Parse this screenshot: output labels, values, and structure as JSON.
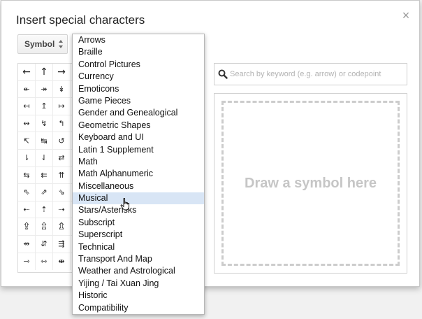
{
  "dialog": {
    "title": "Insert special characters",
    "close_glyph": "×"
  },
  "category_select": {
    "value": "Symbol"
  },
  "symbol_grid": {
    "rows": [
      [
        "←",
        "↑",
        "→"
      ],
      [
        "↞",
        "↠",
        "↡"
      ],
      [
        "↤",
        "↥",
        "↦"
      ],
      [
        "↭",
        "↯",
        "↰"
      ],
      [
        "↸",
        "↹",
        "↺"
      ],
      [
        "⇂",
        "⇃",
        "⇄"
      ],
      [
        "⇆",
        "⇇",
        "⇈"
      ],
      [
        "⇖",
        "⇗",
        "⇘"
      ],
      [
        "⇠",
        "⇡",
        "⇢"
      ],
      [
        "⇪",
        "⇫",
        "⇬"
      ],
      [
        "⇴",
        "⇵",
        "⇶"
      ],
      [
        "⇾",
        "⇿",
        "⇼"
      ]
    ]
  },
  "search": {
    "value": "",
    "placeholder": "Search by keyword (e.g. arrow) or codepoint",
    "icon": "search-icon"
  },
  "draw_area": {
    "label": "Draw a symbol here"
  },
  "dropdown": {
    "selected_index": 13,
    "options": [
      "Arrows",
      "Braille",
      "Control Pictures",
      "Currency",
      "Emoticons",
      "Game Pieces",
      "Gender and Genealogical",
      "Geometric Shapes",
      "Keyboard and UI",
      "Latin 1 Supplement",
      "Math",
      "Math Alphanumeric",
      "Miscellaneous",
      "Musical",
      "Stars/Asterisks",
      "Subscript",
      "Superscript",
      "Technical",
      "Transport And Map",
      "Weather and Astrological",
      "Yijing / Tai Xuan Jing",
      "Historic",
      "Compatibility"
    ]
  },
  "colors": {
    "selected_option_bg": "#d8e5f5",
    "dashed_border": "#cccccc",
    "placeholder_text": "#b3b3b3"
  }
}
